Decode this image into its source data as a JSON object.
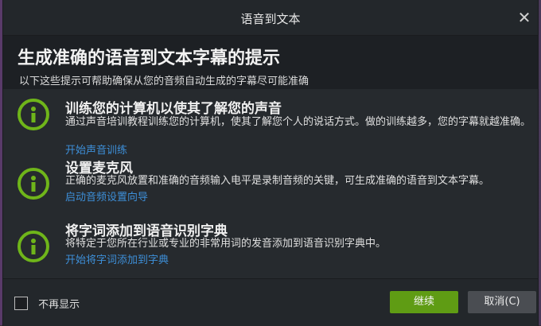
{
  "window": {
    "title": "语音到文本"
  },
  "header": {
    "heading": "生成准确的语音到文本字幕的提示",
    "subtitle": "以下这些提示可帮助确保从您的音频自动生成的字幕尽可能准确"
  },
  "tips": [
    {
      "title": "训练您的计算机以使其了解您的声音",
      "desc": "通过声音培训教程训练您的计算机，使其了解您个人的说话方式。做的训练越多，您的字幕就越准确。",
      "link": "开始声音训练"
    },
    {
      "title": "设置麦克风",
      "desc": "正确的麦克风放置和准确的音频输入电平是录制音频的关键，可生成准确的语音到文本字幕。",
      "link": "启动音频设置向导"
    },
    {
      "title": "将字词添加到语音识别字典",
      "desc": "将特定于您所在行业或专业的非常用词的发音添加到语音识别字典中。",
      "link": "开始将字词添加到字典"
    }
  ],
  "footer": {
    "dont_show_label": "不再显示",
    "dont_show_checked": false,
    "continue_label": "继续",
    "cancel_label": "取消(C)"
  },
  "icons": {
    "close": "close-icon",
    "info": "info-icon"
  },
  "colors": {
    "accent_green": "#6fb51a",
    "continue_button": "#5f9c14",
    "link": "#3d8fd8"
  }
}
